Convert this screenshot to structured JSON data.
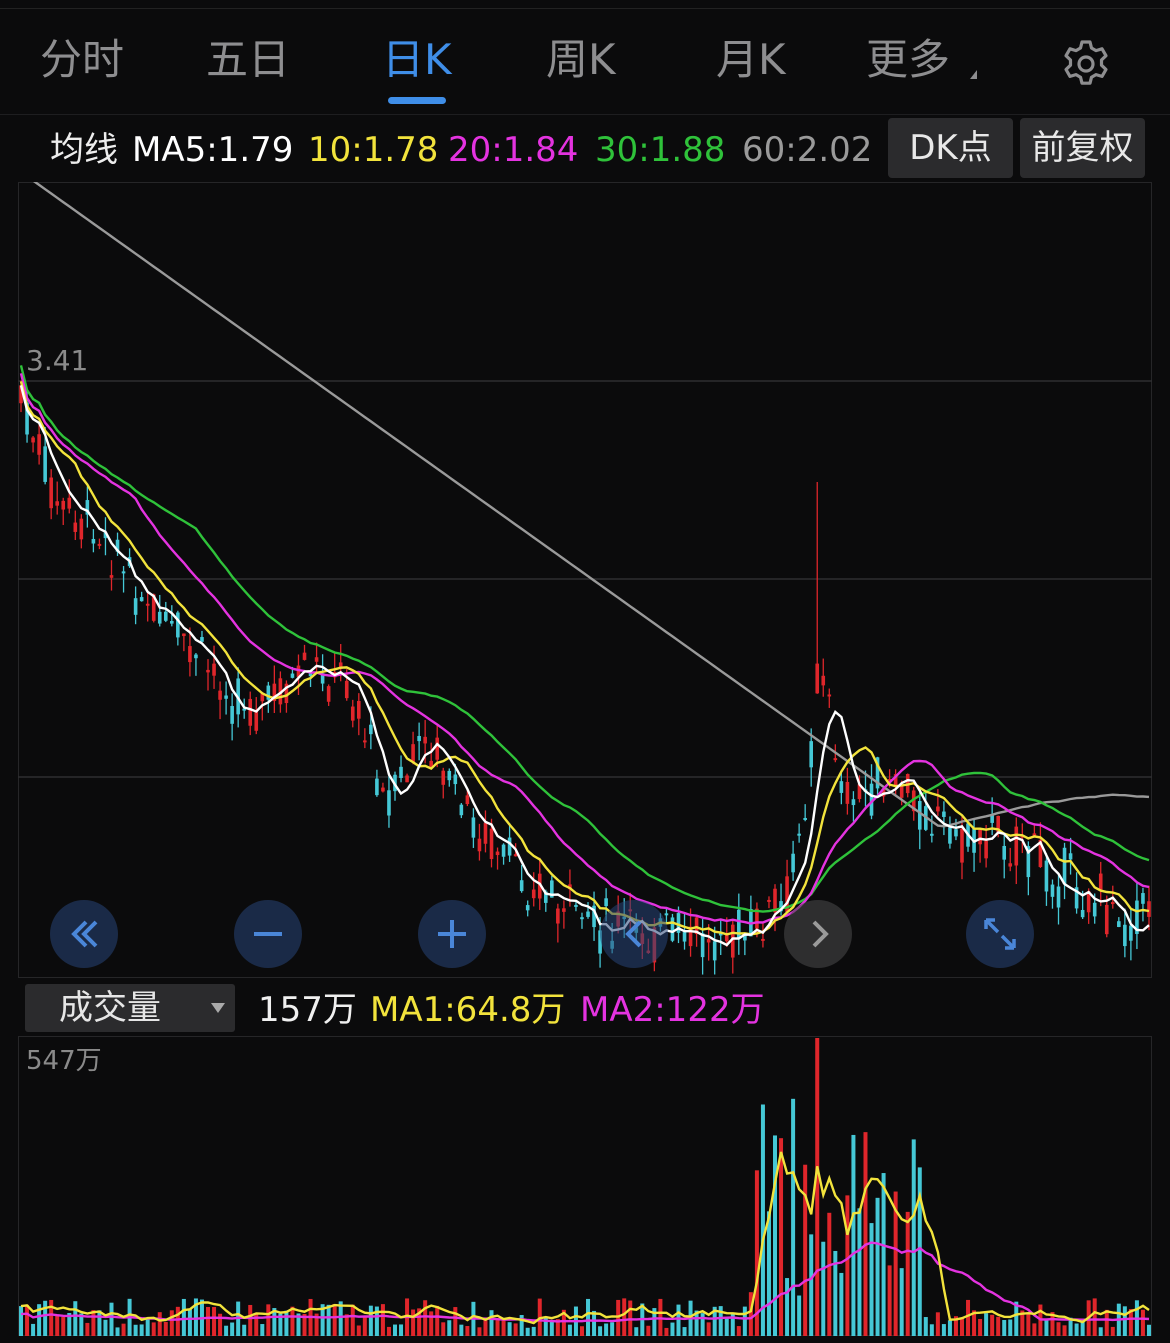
{
  "tabs": [
    {
      "label": "分时"
    },
    {
      "label": "五日"
    },
    {
      "label": "日K",
      "active": true
    },
    {
      "label": "周K"
    },
    {
      "label": "月K"
    },
    {
      "label": "更多"
    }
  ],
  "ma": {
    "title": "均线",
    "ma5": "MA5:1.79",
    "ma10": "10:1.78",
    "ma20": "20:1.84",
    "ma30": "30:1.88",
    "ma60": "60:2.02"
  },
  "buttons": {
    "dk": "DK点",
    "restore": "前复权"
  },
  "price_axis": {
    "label": "3.41"
  },
  "volume": {
    "selector": "成交量",
    "current": "157万",
    "ma1": "MA1:64.8万",
    "ma2": "MA2:122万",
    "max_label": "547万"
  },
  "colors": {
    "up": "#e0262b",
    "down": "#45c8d6",
    "ma5": "#ffffff",
    "ma10": "#f2e33c",
    "ma20": "#e433e0",
    "ma30": "#2fc23a",
    "ma60": "#9a9a9a",
    "accent": "#3f8ee8"
  },
  "icons": {
    "settings": "gear-icon",
    "scroll_left": "double-chevron-left-icon",
    "zoom_out": "minus-icon",
    "zoom_in": "plus-icon",
    "prev": "chevron-left-icon",
    "next": "chevron-right-icon",
    "fullscreen": "expand-icon"
  }
}
